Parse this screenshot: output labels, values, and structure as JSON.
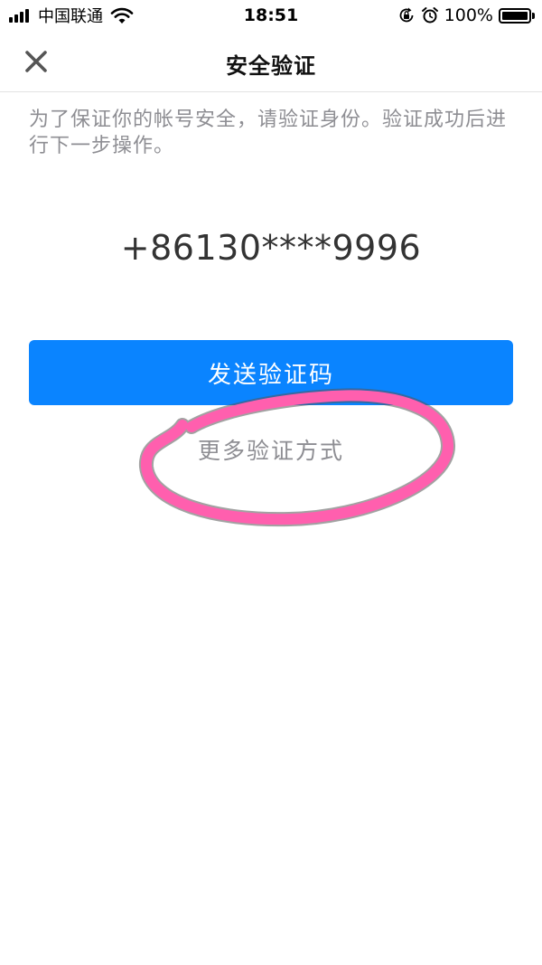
{
  "status_bar": {
    "carrier": "中国联通",
    "time": "18:51",
    "battery_percent": "100%",
    "icons": [
      "signal-icon",
      "wifi-icon",
      "rotation-lock-icon",
      "alarm-icon",
      "battery-icon"
    ]
  },
  "nav": {
    "title": "安全验证",
    "close_icon": "close-icon"
  },
  "content": {
    "hint": "为了保证你的帐号安全，请验证身份。验证成功后进行下一步操作。",
    "phone_number": "+86130****9996",
    "send_button_label": "发送验证码",
    "more_methods_label": "更多验证方式"
  },
  "colors": {
    "primary": "#0a84ff",
    "muted_text": "#8e8e93",
    "annotation": "#ff5fae"
  }
}
